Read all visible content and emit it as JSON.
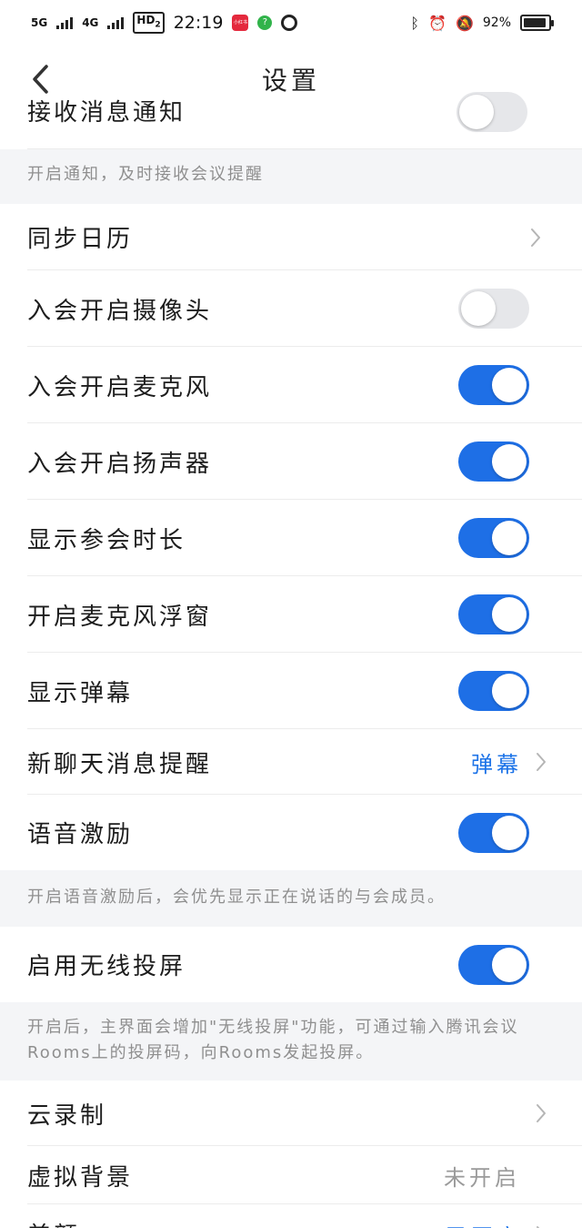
{
  "status_bar": {
    "net1": "5G",
    "net2": "4G",
    "hd": "HD",
    "hd_sub": "2",
    "time": "22:19",
    "app_badge": "小红书",
    "battery": "92%"
  },
  "nav": {
    "title": "设置"
  },
  "rows": {
    "receive_notify": {
      "label": "接收消息通知",
      "on": false
    },
    "notify_hint": "开启通知，及时接收会议提醒",
    "sync_calendar": {
      "label": "同步日历"
    },
    "camera": {
      "label": "入会开启摄像头",
      "on": false
    },
    "mic": {
      "label": "入会开启麦克风",
      "on": true
    },
    "speaker": {
      "label": "入会开启扬声器",
      "on": true
    },
    "duration": {
      "label": "显示参会时长",
      "on": true
    },
    "mic_float": {
      "label": "开启麦克风浮窗",
      "on": true
    },
    "danmaku": {
      "label": "显示弹幕",
      "on": true
    },
    "chat_remind": {
      "label": "新聊天消息提醒",
      "value": "弹幕"
    },
    "voice_incentive": {
      "label": "语音激励",
      "on": true
    },
    "voice_hint": "开启语音激励后，会优先显示正在说话的与会成员。",
    "wireless": {
      "label": "启用无线投屏",
      "on": true
    },
    "wireless_hint": "开启后，主界面会增加\"无线投屏\"功能，可通过输入腾讯会议Rooms上的投屏码，向Rooms发起投屏。",
    "cloud_record": {
      "label": "云录制"
    },
    "virtual_bg": {
      "label": "虚拟背景",
      "value": "未开启"
    },
    "beauty": {
      "label": "美颜",
      "value": "已开启"
    }
  },
  "colors": {
    "accent": "#1e6fe6",
    "toggle_off": "#e6e7ea",
    "hint_text": "#8f8f8f"
  }
}
